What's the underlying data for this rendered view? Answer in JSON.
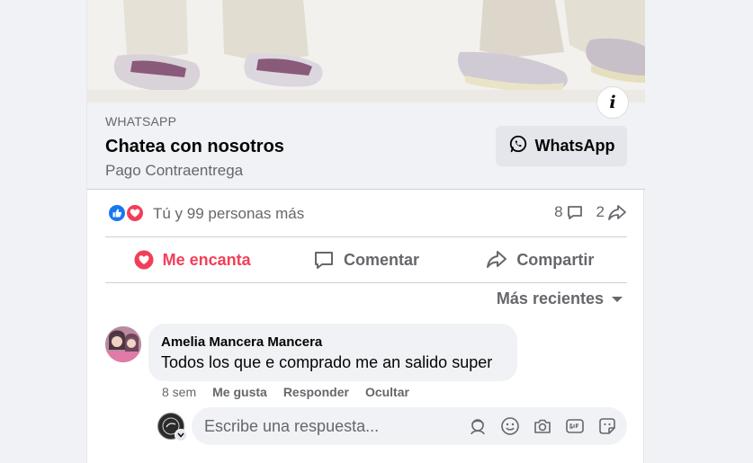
{
  "link_preview": {
    "source": "WHATSAPP",
    "title": "Chatea con nosotros",
    "description": "Pago Contraentrega",
    "button_label": "WhatsApp"
  },
  "info_icon": "i",
  "reactions": {
    "summary": "Tú y 99 personas más",
    "comments_count": "8",
    "shares_count": "2"
  },
  "actions": {
    "love_label": "Me encanta",
    "comment_label": "Comentar",
    "share_label": "Compartir"
  },
  "sort": {
    "label": "Más recientes"
  },
  "comment": {
    "author": "Amelia Mancera Mancera",
    "text": "Todos los que e comprado me an salido super",
    "time": "8 sem",
    "like_label": "Me gusta",
    "reply_label": "Responder",
    "hide_label": "Ocultar"
  },
  "reply_box": {
    "placeholder": "Escribe una respuesta..."
  },
  "colors": {
    "accent_blue": "#1877f2",
    "love_red": "#f33e58",
    "secondary_text": "#65676b"
  }
}
